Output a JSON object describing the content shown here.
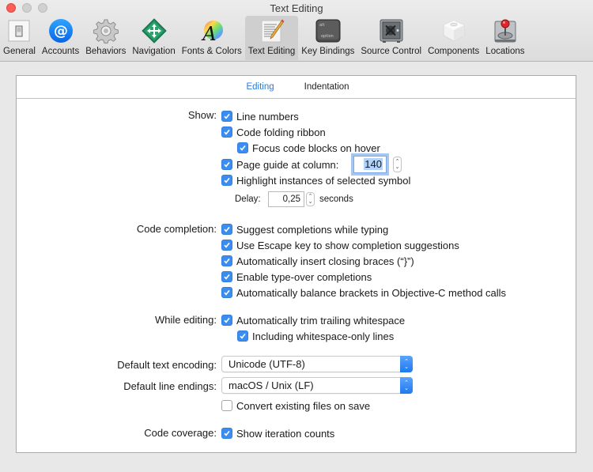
{
  "window": {
    "title": "Text Editing"
  },
  "toolbar": {
    "items": [
      {
        "label": "General",
        "icon": "general-switch-icon",
        "selected": false
      },
      {
        "label": "Accounts",
        "icon": "at-sign-icon",
        "selected": false
      },
      {
        "label": "Behaviors",
        "icon": "gear-icon",
        "selected": false
      },
      {
        "label": "Navigation",
        "icon": "navigation-arrows-icon",
        "selected": false
      },
      {
        "label": "Fonts & Colors",
        "icon": "font-color-wheel-icon",
        "selected": false
      },
      {
        "label": "Text Editing",
        "icon": "document-pencil-icon",
        "selected": true
      },
      {
        "label": "Key Bindings",
        "icon": "option-key-icon",
        "selected": false
      },
      {
        "label": "Source Control",
        "icon": "vault-icon",
        "selected": false
      },
      {
        "label": "Components",
        "icon": "cube-icon",
        "selected": false
      },
      {
        "label": "Locations",
        "icon": "joystick-drive-icon",
        "selected": false
      }
    ],
    "key_icon_top": "alt",
    "key_icon_bottom": "option"
  },
  "tabs": [
    {
      "label": "Editing",
      "active": true
    },
    {
      "label": "Indentation",
      "active": false
    }
  ],
  "show": {
    "label": "Show:",
    "line_numbers": {
      "label": "Line numbers",
      "checked": true
    },
    "code_folding_ribbon": {
      "label": "Code folding ribbon",
      "checked": true
    },
    "focus_code_blocks": {
      "label": "Focus code blocks on hover",
      "checked": true
    },
    "page_guide": {
      "label": "Page guide at column:",
      "checked": true,
      "value": "140"
    },
    "highlight_instances": {
      "label": "Highlight instances of selected symbol",
      "checked": true
    },
    "delay": {
      "label": "Delay:",
      "value": "0,25",
      "unit": "seconds"
    }
  },
  "code_completion": {
    "label": "Code completion:",
    "options": [
      {
        "label": "Suggest completions while typing",
        "checked": true
      },
      {
        "label": "Use Escape key to show completion suggestions",
        "checked": true
      },
      {
        "label": "Automatically insert closing braces (“}”)",
        "checked": true
      },
      {
        "label": "Enable type-over completions",
        "checked": true
      },
      {
        "label": "Automatically balance brackets in Objective-C method calls",
        "checked": true
      }
    ]
  },
  "while_editing": {
    "label": "While editing:",
    "trim_whitespace": {
      "label": "Automatically trim trailing whitespace",
      "checked": true
    },
    "whitespace_only_lines": {
      "label": "Including whitespace-only lines",
      "checked": true
    }
  },
  "encoding": {
    "label": "Default text encoding:",
    "value": "Unicode (UTF-8)"
  },
  "line_endings": {
    "label": "Default line endings:",
    "value": "macOS / Unix (LF)",
    "convert": {
      "label": "Convert existing files on save",
      "checked": false
    }
  },
  "code_coverage": {
    "label": "Code coverage:",
    "iteration_counts": {
      "label": "Show iteration counts",
      "checked": true
    }
  },
  "colors": {
    "accent": "#3b8ef0",
    "tab_active": "#2a7ad8",
    "close_button": "#fc5d57"
  }
}
